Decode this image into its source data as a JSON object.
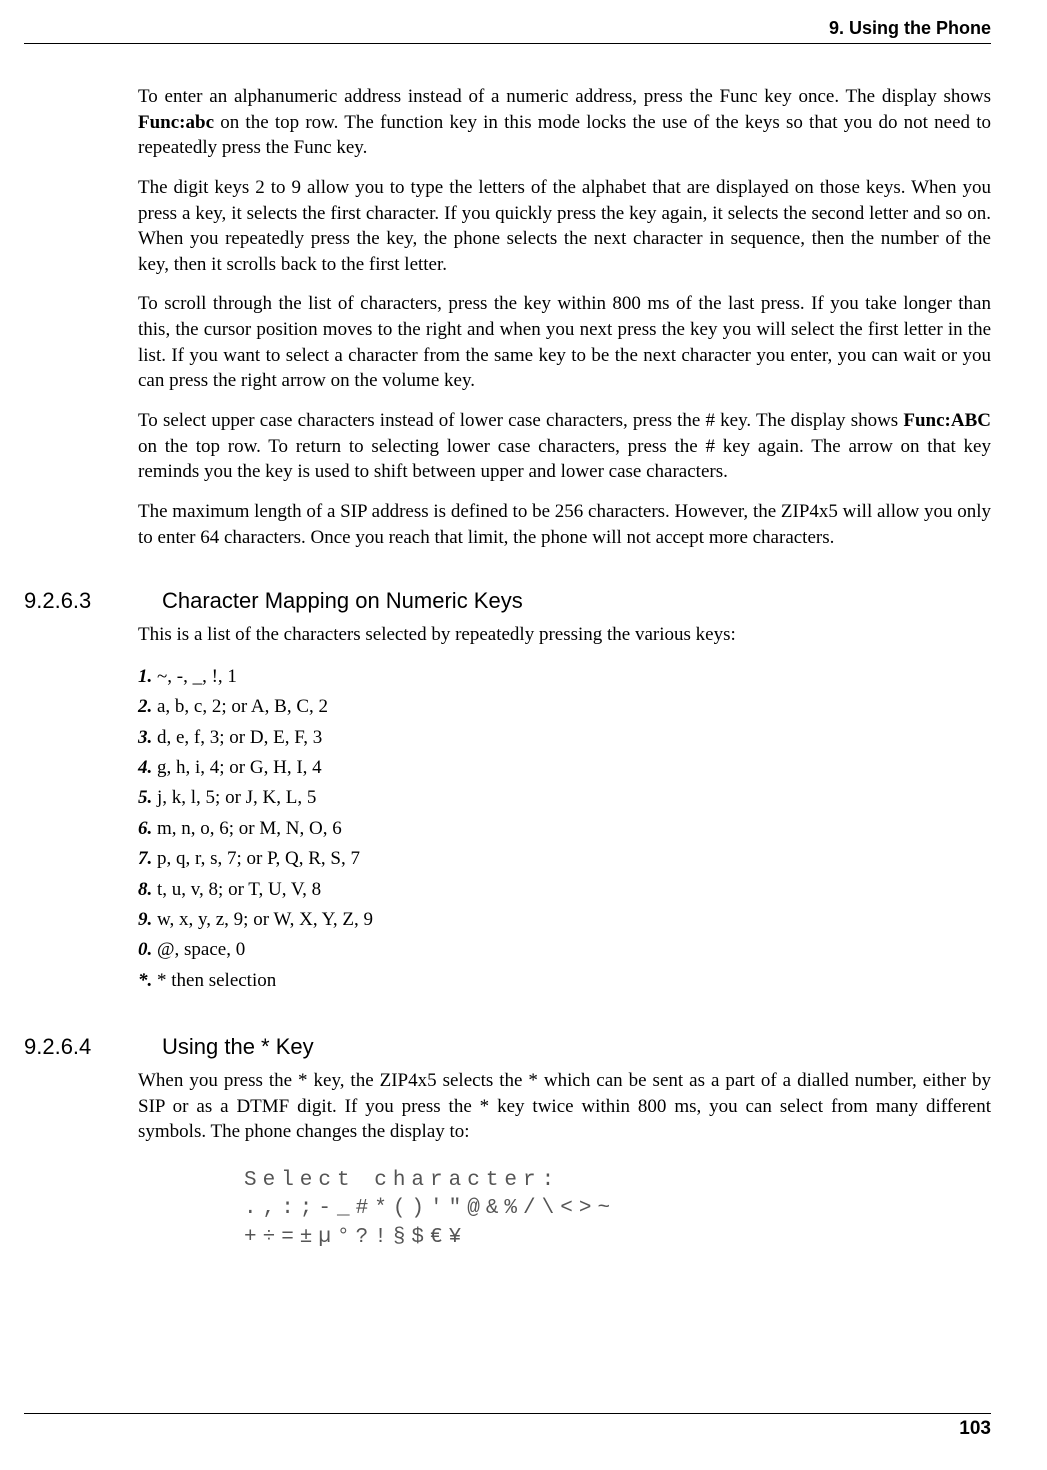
{
  "header": {
    "running_head": "9. Using the Phone"
  },
  "paragraphs": {
    "p1a": "To enter an alphanumeric address instead of a numeric address, press the Func key once. The display shows ",
    "p1bold": "Func:abc",
    "p1b": " on the top row. The function key in this mode locks the use of the keys so that you do not need to repeatedly press the Func key.",
    "p2": "The digit keys 2 to 9 allow you to type the letters of the alphabet that are displayed on those keys. When you press a key, it selects the first character. If you quickly press the key again, it selects the second letter and so on. When you repeatedly press the key, the phone selects the next character in sequence, then the number of the key, then it scrolls back to the first letter.",
    "p3": "To scroll through the list of characters, press the key within 800 ms of the last press. If you take longer than this, the cursor position moves to the right and when you next press the key you will select the first letter in the list. If you want to select a character from the same key to be the next character you enter, you can wait or you can press the right arrow on the volume key.",
    "p4a": "To select upper case characters instead of lower case characters, press the # key. The display shows ",
    "p4bold": "Func:ABC",
    "p4b": " on the top row. To return to selecting lower case characters, press the # key again. The arrow on that key reminds you the key is used to shift between upper and lower case characters.",
    "p5": "The maximum length of a SIP address is defined to be 256 characters. However, the ZIP4x5 will allow you only to enter 64 characters. Once you reach that limit, the phone will not accept more characters."
  },
  "section1": {
    "number": "9.2.6.3",
    "title": "Character Mapping on Numeric Keys",
    "intro": "This is a list of the characters selected by repeatedly pressing the various keys:",
    "items": [
      {
        "key": "1.",
        "text": " ~, -, _, !, 1"
      },
      {
        "key": "2.",
        "text": " a, b, c, 2; or A, B, C, 2"
      },
      {
        "key": "3.",
        "text": " d, e, f, 3; or D, E, F, 3"
      },
      {
        "key": "4.",
        "text": " g, h, i, 4; or G, H, I, 4"
      },
      {
        "key": "5.",
        "text": " j, k, l, 5; or J, K, L, 5"
      },
      {
        "key": "6.",
        "text": " m, n, o, 6; or M, N, O, 6"
      },
      {
        "key": "7.",
        "text": " p, q, r, s, 7; or P, Q, R, S, 7"
      },
      {
        "key": "8.",
        "text": " t, u, v, 8; or T, U, V, 8"
      },
      {
        "key": "9.",
        "text": " w, x, y, z, 9; or W, X, Y, Z, 9"
      },
      {
        "key": "0.",
        "text": " @, space, 0"
      },
      {
        "key": "*.",
        "text": " * then selection"
      }
    ]
  },
  "section2": {
    "number": "9.2.6.4",
    "title": "Using the * Key",
    "intro": "When you press the * key, the ZIP4x5 selects the * which can be sent as a part of a dialled number, either by SIP or as a DTMF digit. If you press the * key twice within 800 ms, you can select from many different symbols. The phone changes the display to:",
    "lcd": "Select character:\n.,:;-_#*()'\"@&%/\\<>~\n+÷=±µ°?!§$€¥"
  },
  "footer": {
    "page_number": "103"
  }
}
